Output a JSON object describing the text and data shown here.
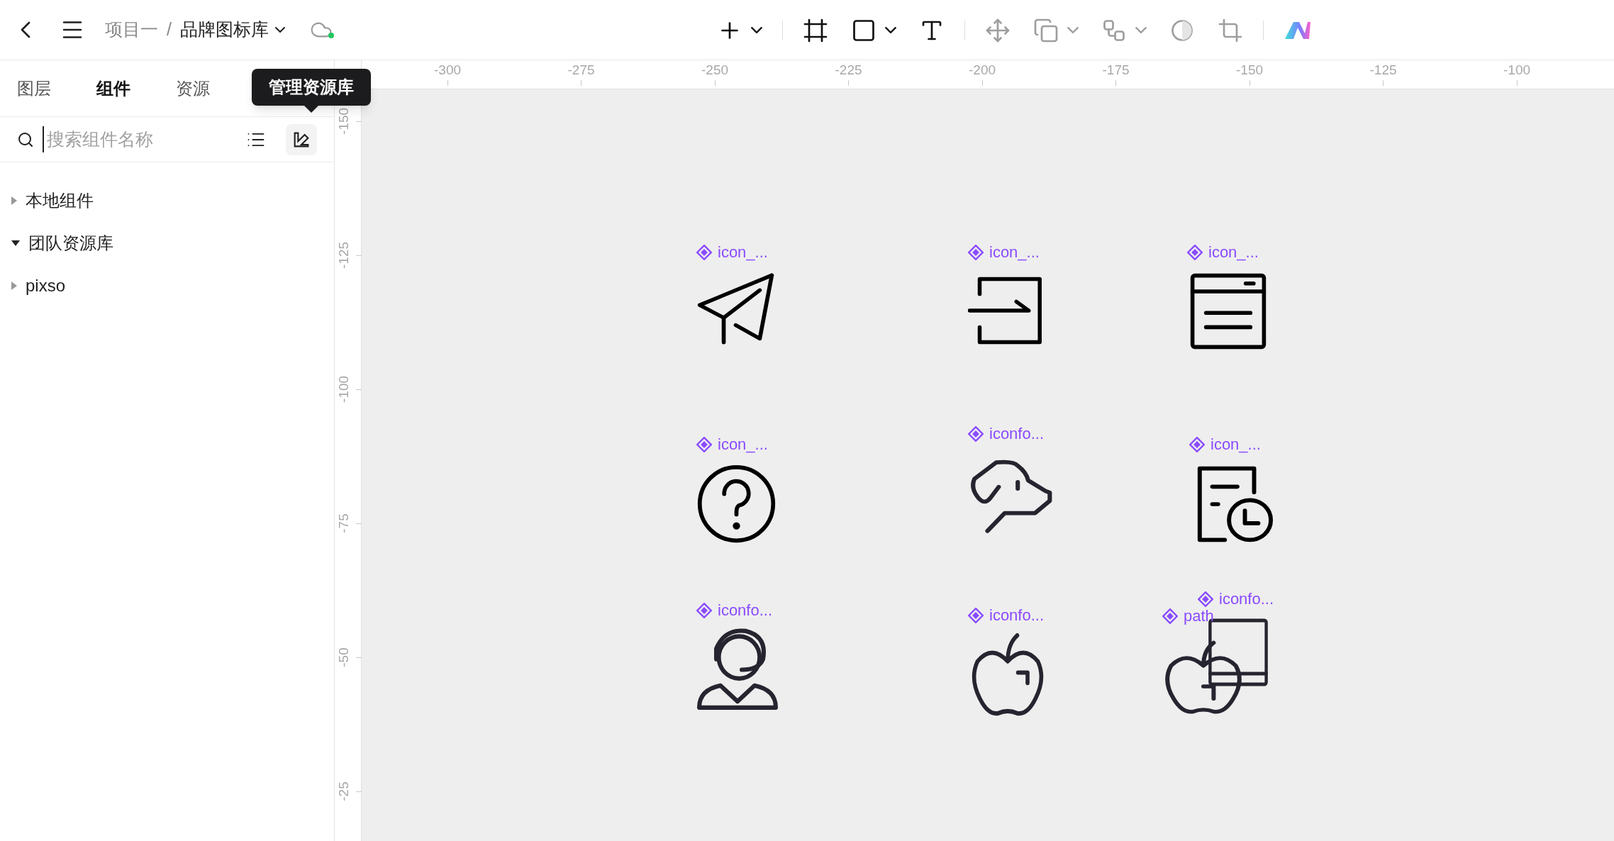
{
  "header": {
    "breadcrumb": {
      "project": "项目一",
      "separator": "/",
      "file": "品牌图标库"
    },
    "sync_online": true
  },
  "toolbar": [
    {
      "kind": "plus",
      "disabled": false,
      "menu": true
    },
    {
      "kind": "frame",
      "disabled": false,
      "menu": false
    },
    {
      "kind": "rect",
      "disabled": false,
      "menu": true
    },
    {
      "kind": "text",
      "disabled": false,
      "menu": false
    },
    {
      "kind": "move",
      "disabled": true,
      "menu": false
    },
    {
      "kind": "boolean",
      "disabled": true,
      "menu": true
    },
    {
      "kind": "component",
      "disabled": true,
      "menu": true
    },
    {
      "kind": "mask",
      "disabled": true,
      "menu": false
    },
    {
      "kind": "crop",
      "disabled": true,
      "menu": false
    },
    {
      "kind": "logo",
      "disabled": false,
      "menu": false
    }
  ],
  "sidebar": {
    "tabs": [
      {
        "label": "图层",
        "selected": false
      },
      {
        "label": "组件",
        "selected": true
      },
      {
        "label": "资源",
        "selected": false
      }
    ],
    "tooltip": "管理资源库",
    "search": {
      "placeholder": "搜索组件名称"
    },
    "tree": [
      {
        "label": "本地组件",
        "expanded": false
      },
      {
        "label": "团队资源库",
        "expanded": true
      },
      {
        "label": "pixso",
        "expanded": false
      }
    ]
  },
  "rulers": {
    "horizontal": [
      "-300",
      "-275",
      "-250",
      "-225",
      "-200",
      "-175",
      "-150",
      "-125",
      "-100"
    ],
    "vertical": [
      "-150",
      "-125",
      "-100",
      "-75",
      "-50",
      "-25"
    ]
  },
  "canvas": {
    "components": [
      {
        "label": "icon_...",
        "kind": "send"
      },
      {
        "label": "icon_...",
        "kind": "login"
      },
      {
        "label": "icon_...",
        "kind": "window"
      },
      {
        "label": "icon_...",
        "kind": "help"
      },
      {
        "label": "iconfo...",
        "kind": "dog"
      },
      {
        "label": "icon_...",
        "kind": "doc-clock"
      },
      {
        "label": "iconfo...",
        "kind": "headset"
      },
      {
        "label": "iconfo...",
        "kind": "apple"
      },
      {
        "label": "iconfo...",
        "kind": "tablet"
      },
      {
        "label": "path",
        "kind": "apple-overlap"
      }
    ]
  }
}
